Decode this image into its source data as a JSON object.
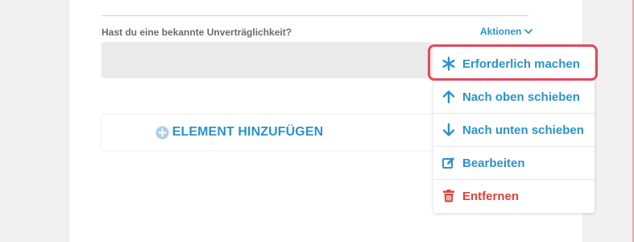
{
  "form": {
    "question_label": "Hast du eine bekannte Unverträglichkeit?",
    "actions_label": "Aktionen",
    "add_element_label": "ELEMENT HINZUFÜGEN"
  },
  "dropdown": {
    "items": [
      {
        "label": "Erforderlich machen",
        "icon": "asterisk-icon",
        "highlighted": true
      },
      {
        "label": "Nach oben schieben",
        "icon": "arrow-up-icon"
      },
      {
        "label": "Nach unten schieben",
        "icon": "arrow-down-icon"
      },
      {
        "label": "Bearbeiten",
        "icon": "edit-icon"
      },
      {
        "label": "Entfernen",
        "icon": "trash-icon",
        "danger": true
      }
    ]
  },
  "colors": {
    "accent": "#2b93c9",
    "danger": "#e0403a",
    "highlight_border": "#e24a5f",
    "card_bg": "#ffffff",
    "page_bg": "#f1f1f1",
    "answer_box_bg": "#ebeaea"
  }
}
